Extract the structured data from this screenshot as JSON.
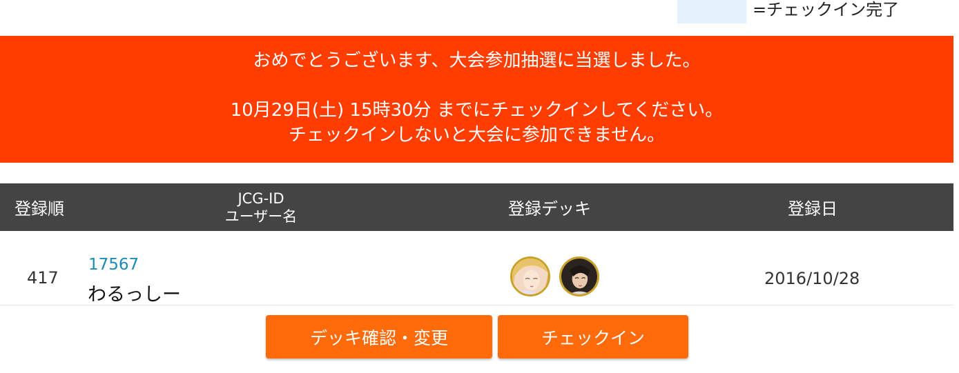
{
  "legend": {
    "swatch_color": "#e3f2fd",
    "label": "=チェックイン完了"
  },
  "banner": {
    "background": "#ff3d00",
    "line1": "おめでとうございます、大会参加抽選に当選しました。",
    "line2": "10月29日(土) 15時30分 までにチェックインしてください。",
    "line3": "チェックインしないと大会に参加できません。"
  },
  "table": {
    "headers": {
      "order": "登録順",
      "id_line1": "JCG-ID",
      "id_line2": "ユーザー名",
      "deck": "登録デッキ",
      "date": "登録日"
    },
    "rows": [
      {
        "order": "417",
        "jcg_id": "17567",
        "username": "わるっしー",
        "deck_icons": [
          "blonde-character-avatar-icon",
          "dark-haired-character-avatar-icon"
        ],
        "date": "2016/10/28"
      }
    ]
  },
  "actions": {
    "deck_button": "デッキ確認・変更",
    "checkin_button": "チェックイン",
    "button_color": "#ff6a0a"
  }
}
